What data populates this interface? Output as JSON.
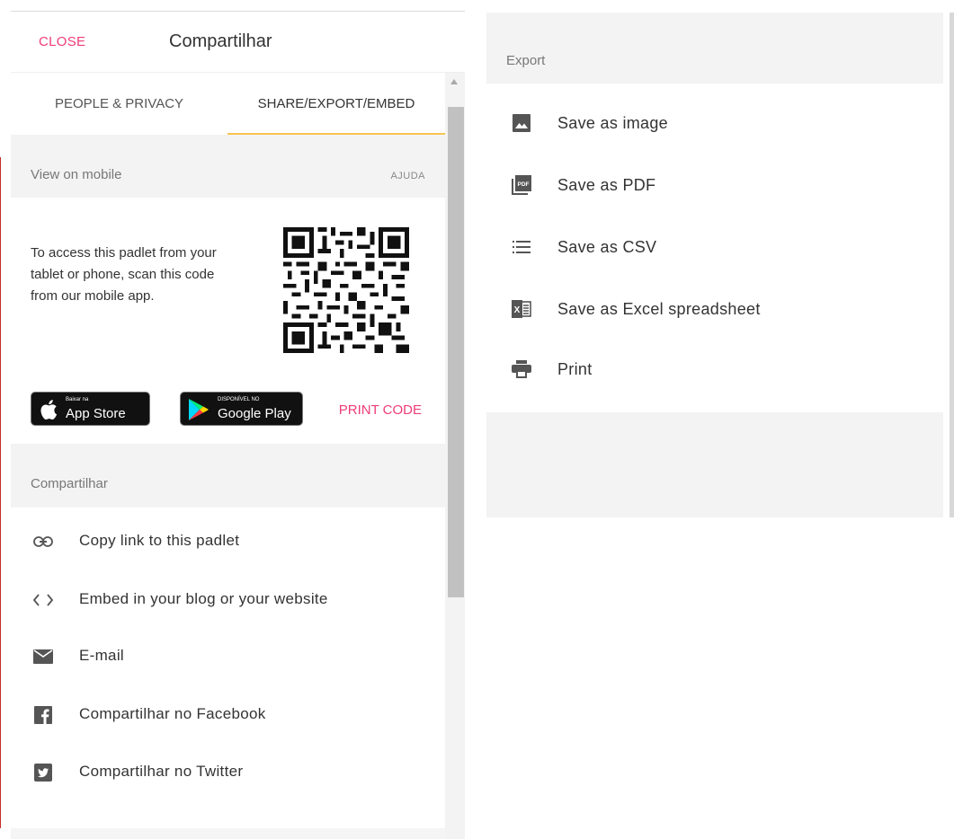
{
  "share_panel": {
    "close_label": "CLOSE",
    "title": "Compartilhar",
    "tabs": [
      {
        "label": "PEOPLE & PRIVACY",
        "active": false
      },
      {
        "label": "SHARE/EXPORT/EMBED",
        "active": true
      }
    ],
    "mobile_section": {
      "label": "View on mobile",
      "help_label": "AJUDA",
      "description": "To access this padlet from your tablet or phone, scan this code from our mobile app.",
      "app_store": {
        "small": "Baixar na",
        "big": "App Store"
      },
      "google_play": {
        "small": "DISPONÍVEL NO",
        "big": "Google Play"
      },
      "print_code_label": "PRINT CODE"
    },
    "share_section": {
      "label": "Compartilhar",
      "items": [
        {
          "label": "Copy link to this padlet",
          "icon": "link-icon"
        },
        {
          "label": "Embed in your blog or your website",
          "icon": "code-icon"
        },
        {
          "label": "E-mail",
          "icon": "email-icon"
        },
        {
          "label": "Compartilhar no Facebook",
          "icon": "facebook-icon"
        },
        {
          "label": "Compartilhar no Twitter",
          "icon": "twitter-icon"
        }
      ]
    }
  },
  "export_panel": {
    "label": "Export",
    "items": [
      {
        "label": "Save as image",
        "icon": "image-icon"
      },
      {
        "label": "Save as PDF",
        "icon": "pdf-icon"
      },
      {
        "label": "Save as CSV",
        "icon": "list-icon"
      },
      {
        "label": "Save as Excel spreadsheet",
        "icon": "excel-icon"
      },
      {
        "label": "Print",
        "icon": "print-icon"
      }
    ]
  },
  "colors": {
    "accent_pink": "#ee3d7a",
    "tab_underline": "#f7c44f",
    "section_bg": "#f3f3f3"
  }
}
